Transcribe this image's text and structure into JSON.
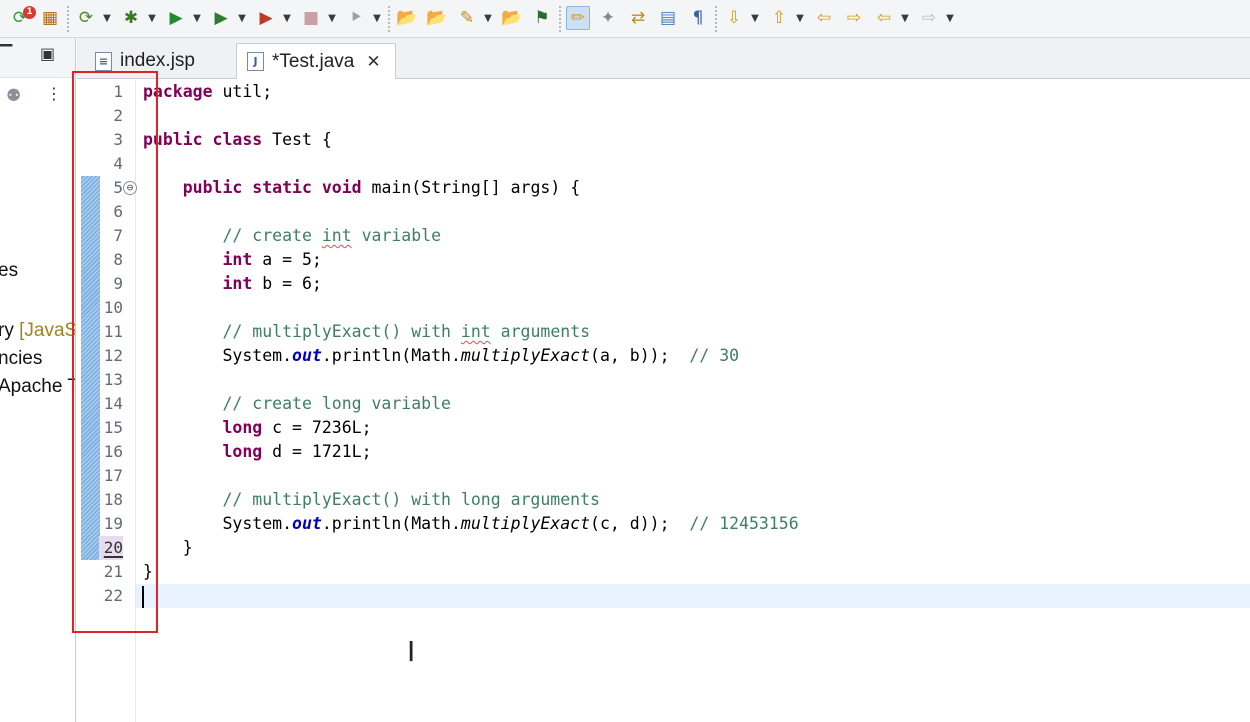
{
  "toolbar": {
    "items": [
      {
        "icon": "refresh-icon",
        "glyph": "⟳",
        "color": "#2e9c3a",
        "dropdown": false,
        "badge": "1"
      },
      {
        "icon": "gift-box-icon",
        "glyph": "▦",
        "color": "#b06a16",
        "dropdown": false
      },
      {
        "icon": "build-icon",
        "glyph": "⟳",
        "color": "#4a8b2a",
        "dropdown": true
      },
      {
        "icon": "debug-bug-icon",
        "glyph": "✱",
        "color": "#3a7a22",
        "dropdown": true
      },
      {
        "icon": "run-icon",
        "glyph": "▶",
        "color": "#1f8a2e",
        "dropdown": true
      },
      {
        "icon": "run-server-icon",
        "glyph": "▶",
        "color": "#2e7d32",
        "dropdown": true
      },
      {
        "icon": "external-tools-icon",
        "glyph": "▶",
        "color": "#c0392b",
        "dropdown": true
      },
      {
        "icon": "stop-icon",
        "glyph": "■",
        "color": "#c8a0a8",
        "dropdown": true
      },
      {
        "icon": "disconnect-icon",
        "glyph": "⯈",
        "color": "#9aa0a8",
        "dropdown": true
      },
      {
        "icon": "open-type-icon",
        "glyph": "📂",
        "color": "#c58a1a",
        "dropdown": false
      },
      {
        "icon": "open-resource-icon",
        "glyph": "📂",
        "color": "#c58a1a",
        "dropdown": false
      },
      {
        "icon": "search-icon",
        "glyph": "✎",
        "color": "#c58a1a",
        "dropdown": true
      },
      {
        "icon": "open-task-icon",
        "glyph": "📂",
        "color": "#c58a1a",
        "dropdown": false
      },
      {
        "icon": "toggle-breadcrumb-icon",
        "glyph": "⚑",
        "color": "#2a6c30",
        "dropdown": false
      },
      {
        "icon": "mark-occurrences-icon",
        "glyph": "✏",
        "color": "#c9a516",
        "dropdown": false,
        "pressed": true
      },
      {
        "icon": "block-selection-icon",
        "glyph": "✦",
        "color": "#8a8a8a",
        "dropdown": false
      },
      {
        "icon": "word-wrap-icon",
        "glyph": "⇄",
        "color": "#c58a1a",
        "dropdown": false
      },
      {
        "icon": "show-source-icon",
        "glyph": "▤",
        "color": "#4a78b8",
        "dropdown": false
      },
      {
        "icon": "show-whitespace-icon",
        "glyph": "¶",
        "color": "#3a5fa8",
        "dropdown": false
      },
      {
        "icon": "next-annotation-icon",
        "glyph": "⇩",
        "color": "#d39a1c",
        "dropdown": true
      },
      {
        "icon": "previous-annotation-icon",
        "glyph": "⇧",
        "color": "#d39a1c",
        "dropdown": true
      },
      {
        "icon": "last-edit-location-icon",
        "glyph": "⇦",
        "color": "#d39a1c",
        "dropdown": false
      },
      {
        "icon": "next-edit-location-icon",
        "glyph": "⇨",
        "color": "#d39a1c",
        "dropdown": false
      },
      {
        "icon": "back-icon",
        "glyph": "⇦",
        "color": "#d39a1c",
        "dropdown": true
      },
      {
        "icon": "forward-icon",
        "glyph": "⇨",
        "color": "#b8bcc2",
        "dropdown": true
      }
    ]
  },
  "left_panel": {
    "items": [
      {
        "text": "es"
      },
      {
        "text": "ry",
        "decoration": "[JavaS"
      },
      {
        "text": "ncies"
      },
      {
        "text": "Apache T"
      }
    ]
  },
  "tabs": [
    {
      "label": "index.jsp",
      "icon": "jsp-file-icon",
      "glyph": "≡",
      "active": false
    },
    {
      "label": "*Test.java",
      "icon": "java-file-icon",
      "glyph": "J",
      "active": true
    }
  ],
  "editor": {
    "lines": [
      {
        "n": "1",
        "tokens": [
          {
            "t": "package",
            "c": "kw"
          },
          {
            "t": " util;"
          }
        ]
      },
      {
        "n": "2",
        "tokens": []
      },
      {
        "n": "3",
        "tokens": [
          {
            "t": "public",
            "c": "kw"
          },
          {
            "t": " "
          },
          {
            "t": "class",
            "c": "kw"
          },
          {
            "t": " Test {"
          }
        ]
      },
      {
        "n": "4",
        "tokens": []
      },
      {
        "n": "5",
        "fold": "⊖",
        "tokens": [
          {
            "t": "    "
          },
          {
            "t": "public",
            "c": "kw"
          },
          {
            "t": " "
          },
          {
            "t": "static",
            "c": "kw"
          },
          {
            "t": " "
          },
          {
            "t": "void",
            "c": "kw"
          },
          {
            "t": " main(String[] args) {"
          }
        ]
      },
      {
        "n": "6",
        "tokens": []
      },
      {
        "n": "7",
        "tokens": [
          {
            "t": "        "
          },
          {
            "t": "// create ",
            "c": "cm"
          },
          {
            "t": "int",
            "c": "cm sq"
          },
          {
            "t": " variable",
            "c": "cm"
          }
        ]
      },
      {
        "n": "8",
        "tokens": [
          {
            "t": "        "
          },
          {
            "t": "int",
            "c": "kw"
          },
          {
            "t": " a = 5;"
          }
        ]
      },
      {
        "n": "9",
        "tokens": [
          {
            "t": "        "
          },
          {
            "t": "int",
            "c": "kw"
          },
          {
            "t": " b = 6;"
          }
        ]
      },
      {
        "n": "10",
        "tokens": []
      },
      {
        "n": "11",
        "tokens": [
          {
            "t": "        "
          },
          {
            "t": "// multiplyExact() with ",
            "c": "cm"
          },
          {
            "t": "int",
            "c": "cm sq"
          },
          {
            "t": " arguments",
            "c": "cm"
          }
        ]
      },
      {
        "n": "12",
        "tokens": [
          {
            "t": "        System."
          },
          {
            "t": "out",
            "c": "fd"
          },
          {
            "t": ".println(Math."
          },
          {
            "t": "multiplyExact",
            "c": "it"
          },
          {
            "t": "(a, b));  "
          },
          {
            "t": "// 30",
            "c": "cm"
          }
        ]
      },
      {
        "n": "13",
        "tokens": []
      },
      {
        "n": "14",
        "tokens": [
          {
            "t": "        "
          },
          {
            "t": "// create long variable",
            "c": "cm"
          }
        ]
      },
      {
        "n": "15",
        "tokens": [
          {
            "t": "        "
          },
          {
            "t": "long",
            "c": "kw"
          },
          {
            "t": " c = 7236L;"
          }
        ]
      },
      {
        "n": "16",
        "tokens": [
          {
            "t": "        "
          },
          {
            "t": "long",
            "c": "kw"
          },
          {
            "t": " d = 1721L;"
          }
        ]
      },
      {
        "n": "17",
        "tokens": []
      },
      {
        "n": "18",
        "tokens": [
          {
            "t": "        "
          },
          {
            "t": "// multiplyExact() with long arguments",
            "c": "cm"
          }
        ]
      },
      {
        "n": "19",
        "tokens": [
          {
            "t": "        System."
          },
          {
            "t": "out",
            "c": "fd"
          },
          {
            "t": ".println(Math."
          },
          {
            "t": "multiplyExact",
            "c": "it"
          },
          {
            "t": "(c, d));  "
          },
          {
            "t": "// 12453156",
            "c": "cm"
          }
        ]
      },
      {
        "n": "20",
        "highlight": true,
        "tokens": [
          {
            "t": "    }"
          }
        ]
      },
      {
        "n": "21",
        "tokens": [
          {
            "t": "}"
          }
        ]
      },
      {
        "n": "22",
        "tokens": []
      }
    ]
  }
}
